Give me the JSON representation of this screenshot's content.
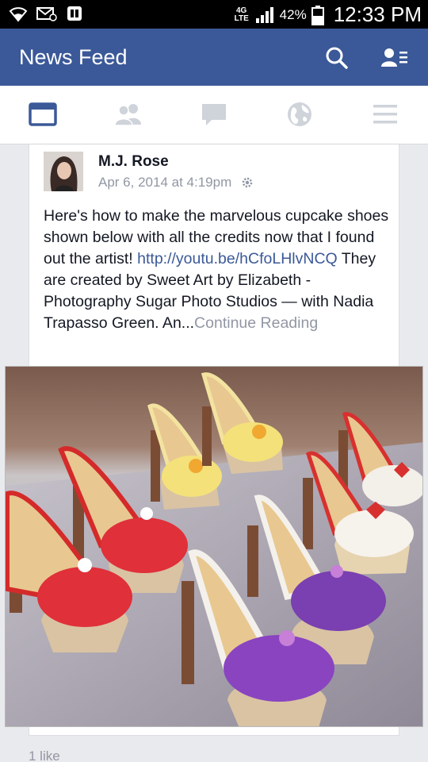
{
  "status_bar": {
    "network": "4G LTE",
    "battery_percent": "42%",
    "time": "12:33 PM"
  },
  "header": {
    "title": "News Feed",
    "search_icon": "search-icon",
    "friends_icon": "friend-requests-icon"
  },
  "tabs": [
    {
      "name": "news-feed",
      "icon": "news-feed-icon",
      "active": true
    },
    {
      "name": "friends",
      "icon": "friends-icon",
      "active": false
    },
    {
      "name": "messages",
      "icon": "messages-icon",
      "active": false
    },
    {
      "name": "notifications",
      "icon": "globe-icon",
      "active": false
    },
    {
      "name": "more",
      "icon": "menu-icon",
      "active": false
    }
  ],
  "post": {
    "author": "M.J. Rose",
    "timestamp": "Apr 6, 2014 at 4:19pm",
    "text_before_link": "Here's how to make the marvelous cupcake shoes shown below with all the credits now that I found out the artist! ",
    "link": "http://youtu.be/hCfoLHlvNCQ",
    "text_after_link": "  They are created by Sweet Art by Elizabeth - Photography Sugar Photo Studios — with Nadia Trapasso Green. An...",
    "continue_label": "Continue Reading",
    "photo_alt": "cupcake shoes photo",
    "likes": "1 like"
  },
  "colors": {
    "brand": "#3b5998",
    "muted": "#9197a3",
    "text": "#141823",
    "background": "#e9eaed"
  }
}
